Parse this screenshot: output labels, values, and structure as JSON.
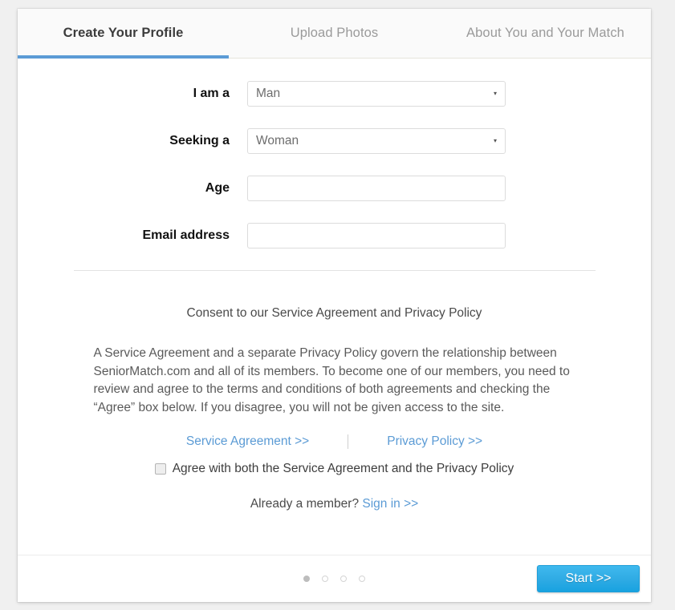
{
  "theme": {
    "page_background": "#f0f0f0",
    "card_background": "#ffffff",
    "accent_blue": "#5b9bd5",
    "link_blue": "#5b9bd5",
    "button_blue": "#2fabe4",
    "label_color": "#111111",
    "body_text_color": "#5a5a5a"
  },
  "tabs": [
    {
      "label": "Create Your Profile",
      "active": true
    },
    {
      "label": "Upload Photos",
      "active": false
    },
    {
      "label": "About You and Your Match",
      "active": false
    }
  ],
  "form": {
    "fields": [
      {
        "label": "I am a",
        "type": "select",
        "value": "Man",
        "placeholder": "",
        "caret": "▾"
      },
      {
        "label": "Seeking a",
        "type": "select",
        "value": "Woman",
        "placeholder": "",
        "caret": "▾"
      },
      {
        "label": "Age",
        "type": "text",
        "value": "",
        "placeholder": ""
      },
      {
        "label": "Email address",
        "type": "text",
        "value": "",
        "placeholder": ""
      }
    ]
  },
  "consent": {
    "heading": "Consent to our Service Agreement and Privacy Policy",
    "body": "A Service Agreement and a separate Privacy Policy govern the relationship between SeniorMatch.com and all of its members. To become one of our members, you need to review and agree to the terms and conditions of both agreements and checking the “Agree” box below. If you disagree, you will not be given access to the site.",
    "service_agreement_link": "Service Agreement >>",
    "privacy_policy_link": "Privacy Policy >>",
    "agree_label": "Agree with both the Service Agreement and the Privacy Policy",
    "agree_checked": false
  },
  "member": {
    "prompt": "Already a member? ",
    "sign_in_link": "Sign in >>"
  },
  "footer": {
    "start_label": "Start >>",
    "dots_total": 4,
    "dot_active_index": 0
  }
}
